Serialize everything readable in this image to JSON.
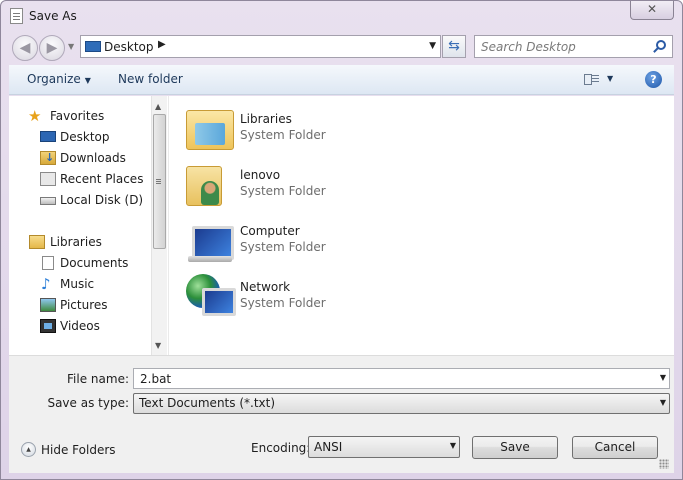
{
  "window": {
    "title": "Save As",
    "close_glyph": "✕"
  },
  "nav": {
    "back_glyph": "◀",
    "forward_glyph": "▶",
    "address": "Desktop",
    "search_placeholder": "Search Desktop"
  },
  "toolbar": {
    "organize": "Organize",
    "new_folder": "New folder",
    "help_glyph": "?"
  },
  "sidebar": {
    "favorites": "Favorites",
    "items": [
      "Desktop",
      "Downloads",
      "Recent Places",
      "Local Disk (D)"
    ],
    "libraries": "Libraries",
    "lib_items": [
      "Documents",
      "Music",
      "Pictures",
      "Videos"
    ]
  },
  "files": [
    {
      "name": "Libraries",
      "type": "System Folder",
      "icon": "libraries-icon"
    },
    {
      "name": "lenovo",
      "type": "System Folder",
      "icon": "user-folder-icon"
    },
    {
      "name": "Computer",
      "type": "System Folder",
      "icon": "computer-icon"
    },
    {
      "name": "Network",
      "type": "System Folder",
      "icon": "network-icon"
    }
  ],
  "form": {
    "file_name_label": "File name:",
    "file_name_value": "2.bat",
    "save_type_label": "Save as type:",
    "save_type_value": "Text Documents (*.txt)"
  },
  "bottom": {
    "hide_folders": "Hide Folders",
    "encoding_label": "Encoding:",
    "encoding_value": "ANSI",
    "save": "Save",
    "cancel": "Cancel"
  }
}
